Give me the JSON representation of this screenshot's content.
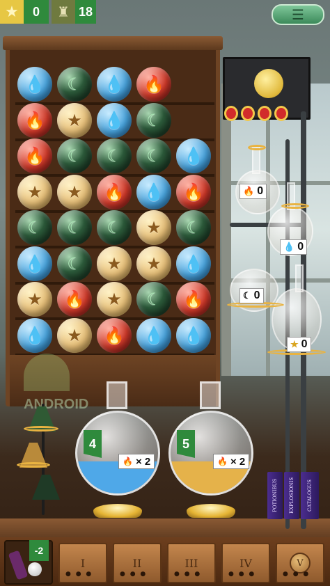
{
  "topbar": {
    "stars_count": "0",
    "robots_count": "18",
    "stars_icon": "gold-star-icon",
    "robots_icon": "robot-icon",
    "menu_icon": "menu-list-icon"
  },
  "grid": {
    "columns": 5,
    "rows": [
      [
        "water",
        "moon",
        "water",
        "fire",
        null
      ],
      [
        "fire",
        "star",
        "water",
        "moon",
        null
      ],
      [
        "fire",
        "moon",
        "moon",
        "moon",
        "water"
      ],
      [
        "star",
        "star",
        "fire",
        "water",
        "fire"
      ],
      [
        "moon",
        "moon",
        "moon",
        "star",
        "moon"
      ],
      [
        "water",
        "moon",
        "star",
        "star",
        "water"
      ],
      [
        "star",
        "fire",
        "star",
        "moon",
        "fire"
      ],
      [
        "water",
        "star",
        "fire",
        "water",
        "water"
      ]
    ],
    "symbols": {
      "water": "💧",
      "moon": "☾",
      "fire": "🔥",
      "star": "★"
    }
  },
  "achievements": {
    "ribbons": 4
  },
  "apparatus_gauges": [
    {
      "icon": "🔥",
      "value": "0"
    },
    {
      "icon": "💧",
      "value": "0"
    },
    {
      "icon": "☾",
      "value": "0"
    },
    {
      "icon": "★",
      "value": "0"
    }
  ],
  "big_flasks": [
    {
      "level": "4",
      "multiplier_icon": "🔥",
      "multiplier": "× 2",
      "liquid_color": "#4fa8e8"
    },
    {
      "level": "5",
      "multiplier_icon": "🔥",
      "multiplier": "× 2",
      "liquid_color": "#e5b24a"
    }
  ],
  "books": [
    "POTIONIBUS",
    "EXPLOSIONIS",
    "CATALOGUS"
  ],
  "watermark": "ANDROID",
  "bottom": {
    "potion_badge": "-2",
    "drawers": [
      "I",
      "II",
      "III",
      "IV",
      "V"
    ]
  }
}
